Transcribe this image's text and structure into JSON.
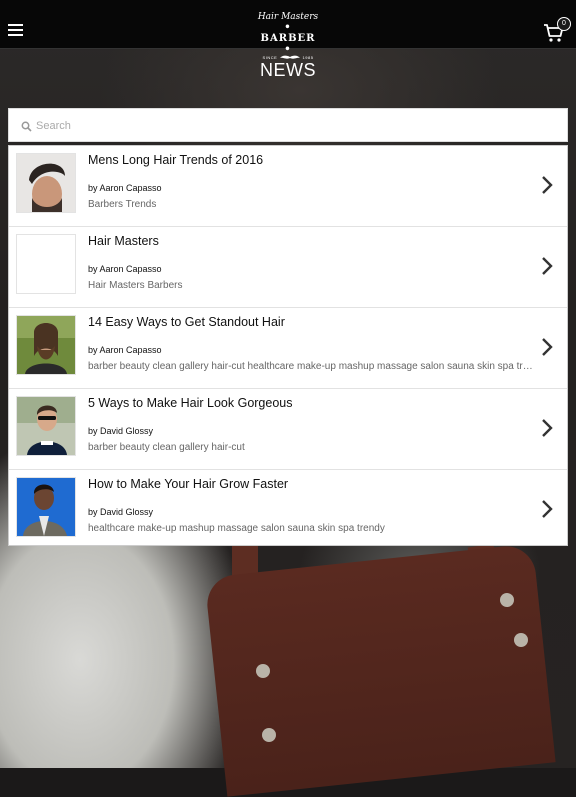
{
  "header": {
    "logo": {
      "script": "Hair Masters",
      "word": "BARBER",
      "since": "SINCE",
      "year": "1985"
    },
    "cart": {
      "count": "0"
    }
  },
  "page": {
    "title": "NEWS"
  },
  "search": {
    "placeholder": "Search",
    "value": ""
  },
  "articles": [
    {
      "title": "Mens Long Hair Trends of 2016",
      "author": "by Aaron Capasso",
      "tags": "Barbers Trends",
      "thumb_icon": "man-undercut-photo"
    },
    {
      "title": "Hair Masters",
      "author": "by Aaron Capasso",
      "tags": "Hair Masters Barbers",
      "thumb_icon": "blank-thumbnail"
    },
    {
      "title": "14 Easy Ways to Get Standout Hair",
      "author": "by Aaron Capasso",
      "tags": "barber beauty clean gallery hair-cut healthcare make-up mashup massage salon sauna skin spa trendy",
      "thumb_icon": "bearded-man-photo"
    },
    {
      "title": "5 Ways to Make Hair Look Gorgeous",
      "author": "by David Glossy",
      "tags": "barber beauty clean gallery hair-cut",
      "thumb_icon": "man-sunglasses-photo"
    },
    {
      "title": "How to Make Your Hair Grow Faster",
      "author": "by David Glossy",
      "tags": "healthcare make-up mashup massage salon sauna skin spa trendy",
      "thumb_icon": "man-suit-photo"
    }
  ],
  "colors": {
    "topbar": "#070707",
    "card": "#ffffff",
    "title_text": "#ffffff"
  }
}
